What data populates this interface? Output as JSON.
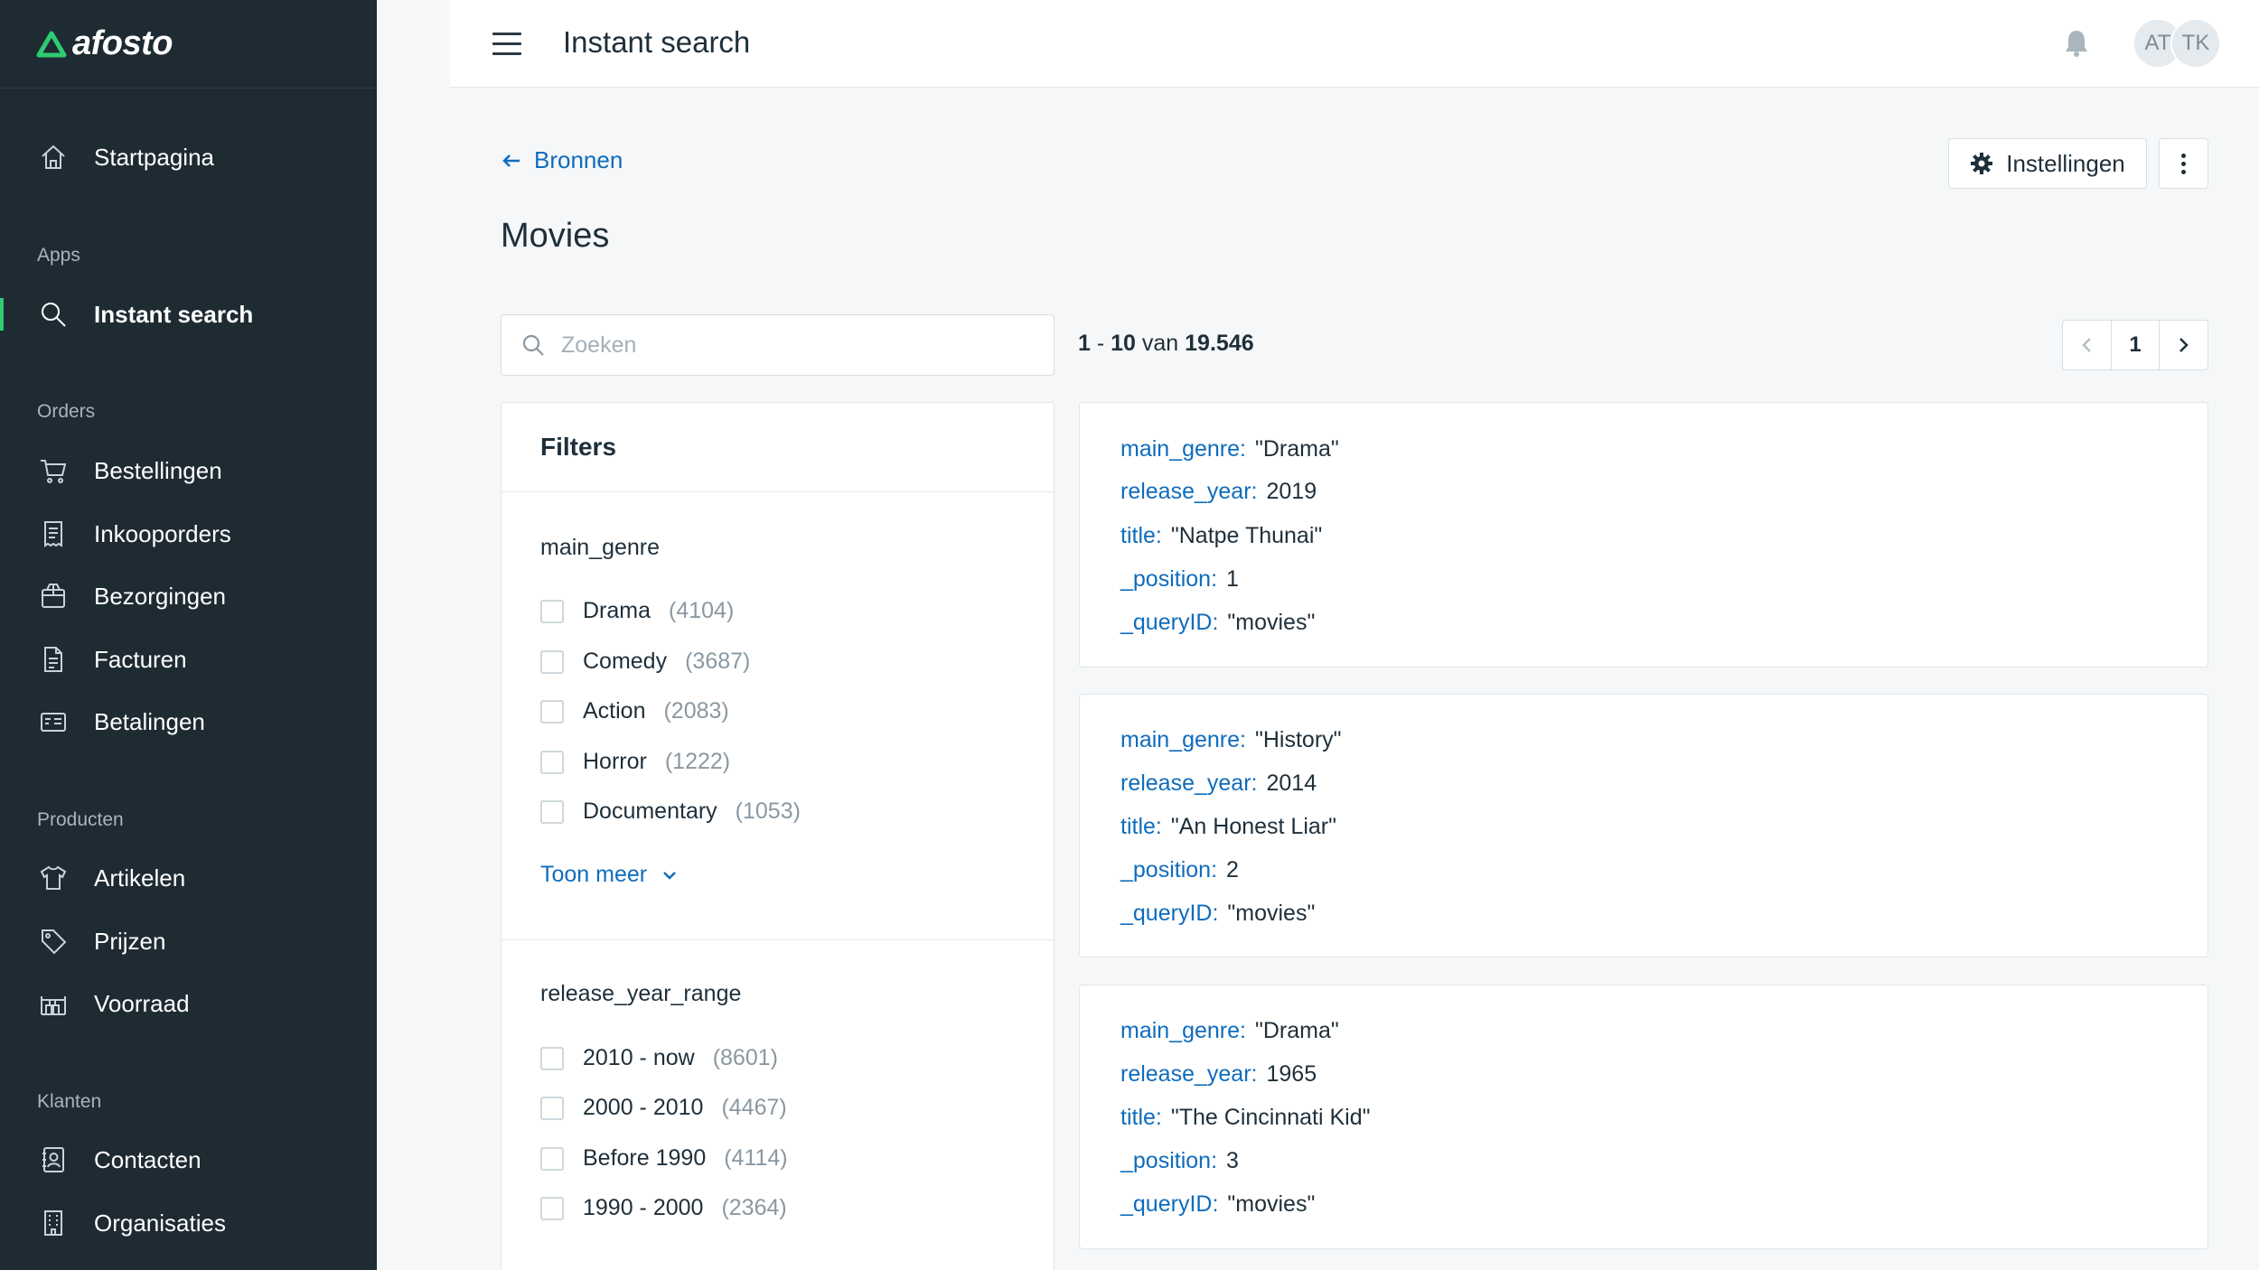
{
  "brand": {
    "name": "afosto"
  },
  "sidebar": {
    "home": {
      "label": "Startpagina"
    },
    "sections": [
      {
        "label": "Apps",
        "items": [
          {
            "label": "Instant search",
            "icon": "search-icon",
            "active": true
          }
        ]
      },
      {
        "label": "Orders",
        "items": [
          {
            "label": "Bestellingen",
            "icon": "cart-icon"
          },
          {
            "label": "Inkooporders",
            "icon": "receipt-icon"
          },
          {
            "label": "Bezorgingen",
            "icon": "box-icon"
          },
          {
            "label": "Facturen",
            "icon": "invoice-icon"
          },
          {
            "label": "Betalingen",
            "icon": "payment-card-icon"
          }
        ]
      },
      {
        "label": "Producten",
        "items": [
          {
            "label": "Artikelen",
            "icon": "shirt-icon"
          },
          {
            "label": "Prijzen",
            "icon": "tag-icon"
          },
          {
            "label": "Voorraad",
            "icon": "warehouse-icon"
          }
        ]
      },
      {
        "label": "Klanten",
        "items": [
          {
            "label": "Contacten",
            "icon": "contact-book-icon"
          },
          {
            "label": "Organisaties",
            "icon": "building-icon"
          }
        ]
      }
    ]
  },
  "topbar": {
    "title": "Instant search",
    "avatars": [
      "AT",
      "TK"
    ]
  },
  "page": {
    "back_label": "Bronnen",
    "title": "Movies",
    "settings_label": "Instellingen"
  },
  "search": {
    "placeholder": "Zoeken",
    "value": ""
  },
  "results_summary": {
    "from": "1",
    "to": "10",
    "word": "van",
    "total": "19.546"
  },
  "pager": {
    "current_page": "1"
  },
  "filters": {
    "title": "Filters",
    "facets": [
      {
        "name": "main_genre",
        "options": [
          {
            "label": "Drama",
            "count": "(4104)"
          },
          {
            "label": "Comedy",
            "count": "(3687)"
          },
          {
            "label": "Action",
            "count": "(2083)"
          },
          {
            "label": "Horror",
            "count": "(1222)"
          },
          {
            "label": "Documentary",
            "count": "(1053)"
          }
        ],
        "show_more": "Toon meer"
      },
      {
        "name": "release_year_range",
        "options": [
          {
            "label": "2010 - now",
            "count": "(8601)"
          },
          {
            "label": "2000 - 2010",
            "count": "(4467)"
          },
          {
            "label": "Before 1990",
            "count": "(4114)"
          },
          {
            "label": "1990 - 2000",
            "count": "(2364)"
          }
        ]
      }
    ]
  },
  "results": [
    {
      "fields": [
        {
          "key": "main_genre:",
          "value": "\"Drama\""
        },
        {
          "key": "release_year:",
          "value": "2019"
        },
        {
          "key": "title:",
          "value": "\"Natpe Thunai\""
        },
        {
          "key": "_position:",
          "value": "1"
        },
        {
          "key": "_queryID:",
          "value": "\"movies\""
        }
      ]
    },
    {
      "fields": [
        {
          "key": "main_genre:",
          "value": "\"History\""
        },
        {
          "key": "release_year:",
          "value": "2014"
        },
        {
          "key": "title:",
          "value": "\"An Honest Liar\""
        },
        {
          "key": "_position:",
          "value": "2"
        },
        {
          "key": "_queryID:",
          "value": "\"movies\""
        }
      ]
    },
    {
      "fields": [
        {
          "key": "main_genre:",
          "value": "\"Drama\""
        },
        {
          "key": "release_year:",
          "value": "1965"
        },
        {
          "key": "title:",
          "value": "\"The Cincinnati Kid\""
        },
        {
          "key": "_position:",
          "value": "3"
        },
        {
          "key": "_queryID:",
          "value": "\"movies\""
        }
      ]
    }
  ],
  "colors": {
    "sidebar_bg": "#1e2b33",
    "accent_green": "#2ecc71",
    "link_blue": "#0f6cbd"
  }
}
